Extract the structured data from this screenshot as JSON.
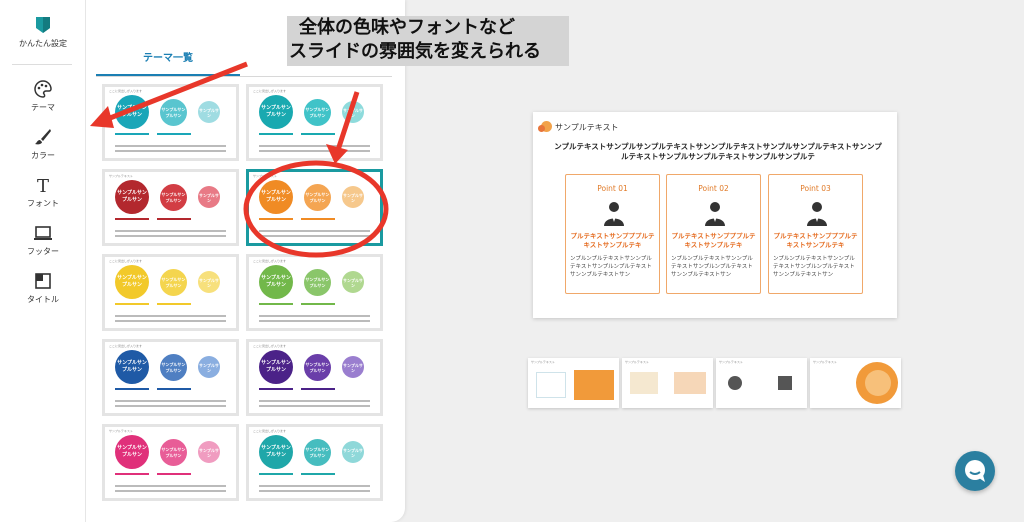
{
  "sidebar": {
    "items": [
      {
        "label": "かんたん設定",
        "icon": "bookmark-shield-icon"
      },
      {
        "label": "テーマ",
        "icon": "palette-icon"
      },
      {
        "label": "カラー",
        "icon": "brush-icon"
      },
      {
        "label": "フォント",
        "icon": "font-T-icon"
      },
      {
        "label": "フッター",
        "icon": "laptop-icon"
      },
      {
        "label": "タイトル",
        "icon": "title-layout-icon"
      }
    ]
  },
  "panel": {
    "tab_label": "テーマ一覧",
    "thumbs": [
      {
        "header": "ここに見出しが入ります",
        "c1": "サンプルサンプルサン",
        "c2": "サンプルサンプルサン",
        "c3": "サンプルサン",
        "colors": [
          "#1aa6b8",
          "#59c5cf",
          "#9fdce2"
        ]
      },
      {
        "header": "ここに見出しが入ります",
        "c1": "サンプルサンプルサン",
        "c2": "サンプルサンプルサン",
        "c3": "サンプルサン",
        "colors": [
          "#19a9b0",
          "#40c3c8",
          "#8edbdc"
        ]
      },
      {
        "header": "サンプルテキスト",
        "c1": "サンプルサンプルサン",
        "c2": "サンプルサンプルサン",
        "c3": "サンプルサン",
        "colors": [
          "#b3282e",
          "#d23d44",
          "#e87a86"
        ]
      },
      {
        "header": "サンプルテキスト",
        "c1": "サンプルサンプルサン",
        "c2": "サンプルサンプルサン",
        "c3": "サンプルサン",
        "colors": [
          "#f08b24",
          "#f4a552",
          "#f6c88c"
        ]
      },
      {
        "header": "ここに見出しが入ります",
        "c1": "サンプルサンプルサン",
        "c2": "サンプルサンプルサン",
        "c3": "サンプルサン",
        "colors": [
          "#f2c92a",
          "#f4d54e",
          "#f7e07c"
        ]
      },
      {
        "header": "ここに見出しが入ります",
        "c1": "サンプルサンプルサン",
        "c2": "サンプルサンプルサン",
        "c3": "サンプルサン",
        "colors": [
          "#72b84a",
          "#8ac66a",
          "#b0d890"
        ]
      },
      {
        "header": "ここに見出しが入ります",
        "c1": "サンプルサンプルサン",
        "c2": "サンプルサンプルサン",
        "c3": "サンプルサン",
        "colors": [
          "#1f5aa6",
          "#4f7fc2",
          "#8aaee0"
        ]
      },
      {
        "header": "ここに見出しが入ります",
        "c1": "サンプルサンプルサン",
        "c2": "サンプルサンプルサン",
        "c3": "サンプルサン",
        "colors": [
          "#4b2288",
          "#6a3ea9",
          "#9a7ecf"
        ]
      },
      {
        "header": "サンプルテキスト",
        "c1": "サンプルサンプルサン",
        "c2": "サンプルサンプルサン",
        "c3": "サンプルサン",
        "colors": [
          "#e0307a",
          "#e85d97",
          "#f09cc0"
        ]
      },
      {
        "header": "ここに見出しが入ります",
        "c1": "サンプルサンプルサン",
        "c2": "サンプルサンプルサン",
        "c3": "サンプルサン",
        "colors": [
          "#1fa7a9",
          "#46bdbf",
          "#8fd8d9"
        ]
      }
    ]
  },
  "annotation": {
    "line1": "全体の色味やフォントなど",
    "line2": "スライドの雰囲気を変えられる"
  },
  "slide": {
    "title": "サンプルテキスト",
    "lead": "ンプルテキストサンプルサンプルテキストサンンプルテキストサンプルサンプルテキストサンンプルテキストサンプルサンプルテキストサンプルサンプルテ",
    "cards": [
      {
        "point": "Point 01",
        "heading": "プルテキストサンプププルテキストサンプルテキ",
        "body": "ンプルンプルテキストサンンプルテキストサンプルンプルテキストサンンプルテキストサン"
      },
      {
        "point": "Point 02",
        "heading": "プルテキストサンプププルテキストサンプルテキ",
        "body": "ンプルンプルテキストサンンプルテキストサンプルンプルテキストサンンプルテキストサン"
      },
      {
        "point": "Point 03",
        "heading": "プルテキストサンプププルテキストサンプルテキ",
        "body": "ンプルンプルテキストサンンプルテキストサンプルンプルテキストサンンプルテキストサン"
      }
    ]
  },
  "strip": {
    "items": [
      {
        "header": "サンプルテキスト"
      },
      {
        "header": "サンプルテキスト"
      },
      {
        "header": "サンプルテキスト"
      },
      {
        "header": "サンプルテキスト"
      }
    ]
  },
  "accent": "#e07a28",
  "annotation_color": "#e8372a",
  "selected_theme_index": 3
}
